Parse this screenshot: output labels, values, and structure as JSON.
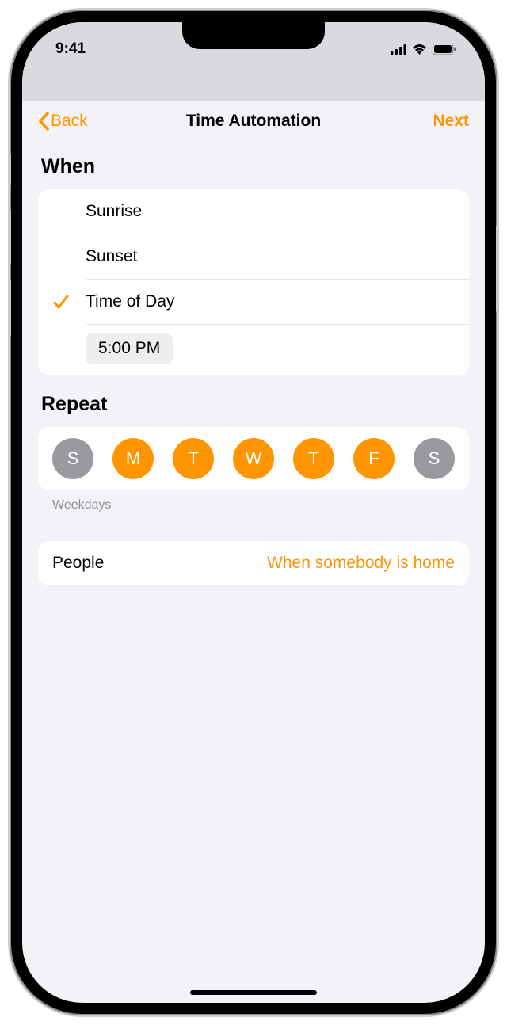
{
  "status": {
    "time": "9:41"
  },
  "nav": {
    "back": "Back",
    "title": "Time Automation",
    "next": "Next"
  },
  "when": {
    "header": "When",
    "options": {
      "sunrise": "Sunrise",
      "sunset": "Sunset",
      "timeOfDay": "Time of Day"
    },
    "selected": "timeOfDay",
    "timeValue": "5:00 PM"
  },
  "repeat": {
    "header": "Repeat",
    "days": [
      {
        "label": "S",
        "active": false
      },
      {
        "label": "M",
        "active": true
      },
      {
        "label": "T",
        "active": true
      },
      {
        "label": "W",
        "active": true
      },
      {
        "label": "T",
        "active": true
      },
      {
        "label": "F",
        "active": true
      },
      {
        "label": "S",
        "active": false
      }
    ],
    "summary": "Weekdays"
  },
  "people": {
    "label": "People",
    "value": "When somebody is home"
  }
}
